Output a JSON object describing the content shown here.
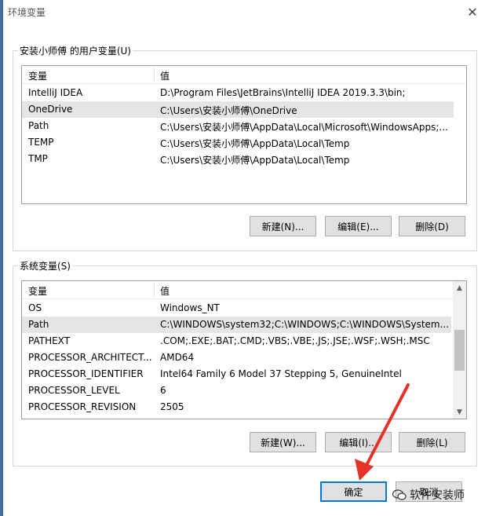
{
  "window": {
    "title": "环境变量"
  },
  "user_vars": {
    "group_title": "安装小师傅 的用户变量(U)",
    "col_var": "变量",
    "col_val": "值",
    "rows": [
      {
        "name": "IntelliJ IDEA",
        "value": "D:\\Program Files\\JetBrains\\IntelliJ IDEA 2019.3.3\\bin;"
      },
      {
        "name": "OneDrive",
        "value": "C:\\Users\\安装小师傅\\OneDrive"
      },
      {
        "name": "Path",
        "value": "C:\\Users\\安装小师傅\\AppData\\Local\\Microsoft\\WindowsApps;..."
      },
      {
        "name": "TEMP",
        "value": "C:\\Users\\安装小师傅\\AppData\\Local\\Temp"
      },
      {
        "name": "TMP",
        "value": "C:\\Users\\安装小师傅\\AppData\\Local\\Temp"
      }
    ],
    "selected_index": 1,
    "btn_new": "新建(N)...",
    "btn_edit": "编辑(E)...",
    "btn_delete": "删除(D)"
  },
  "system_vars": {
    "group_title": "系统变量(S)",
    "col_var": "变量",
    "col_val": "值",
    "rows": [
      {
        "name": "OS",
        "value": "Windows_NT"
      },
      {
        "name": "Path",
        "value": "C:\\WINDOWS\\system32;C:\\WINDOWS;C:\\WINDOWS\\System..."
      },
      {
        "name": "PATHEXT",
        "value": ".COM;.EXE;.BAT;.CMD;.VBS;.VBE;.JS;.JSE;.WSF;.WSH;.MSC"
      },
      {
        "name": "PROCESSOR_ARCHITECT...",
        "value": "AMD64"
      },
      {
        "name": "PROCESSOR_IDENTIFIER",
        "value": "Intel64 Family 6 Model 37 Stepping 5, GenuineIntel"
      },
      {
        "name": "PROCESSOR_LEVEL",
        "value": "6"
      },
      {
        "name": "PROCESSOR_REVISION",
        "value": "2505"
      }
    ],
    "selected_index": 1,
    "btn_new": "新建(W)...",
    "btn_edit": "编辑(I)...",
    "btn_delete": "删除(L)"
  },
  "footer": {
    "ok": "确定",
    "cancel": "取消"
  },
  "watermark": {
    "text": "软件安装师"
  },
  "colors": {
    "accent": "#0078d7",
    "arrow": "#e63329",
    "selection": "#e5e5e5"
  }
}
